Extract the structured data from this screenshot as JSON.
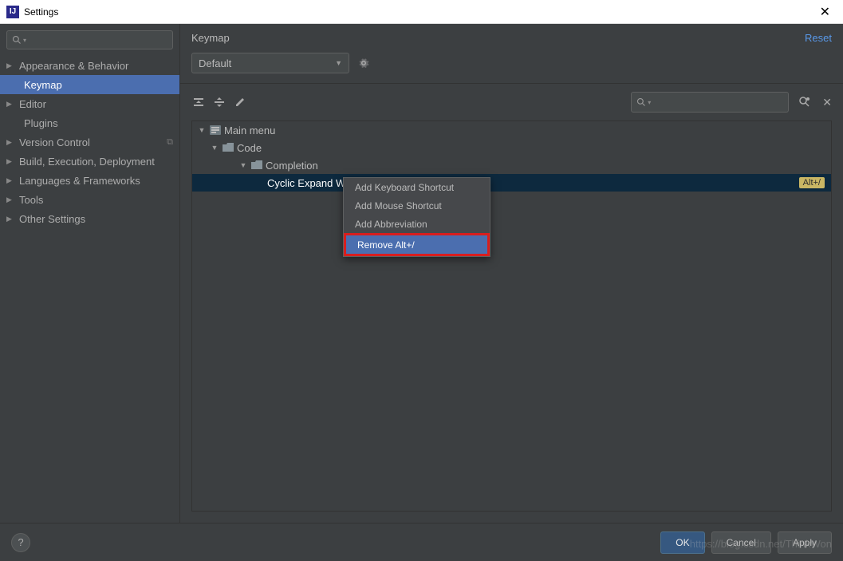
{
  "window": {
    "title": "Settings"
  },
  "sidebar": {
    "items": [
      {
        "label": "Appearance & Behavior",
        "expandable": true
      },
      {
        "label": "Keymap",
        "selected": true
      },
      {
        "label": "Editor",
        "expandable": true
      },
      {
        "label": "Plugins"
      },
      {
        "label": "Version Control",
        "expandable": true,
        "has_copy": true
      },
      {
        "label": "Build, Execution, Deployment",
        "expandable": true
      },
      {
        "label": "Languages & Frameworks",
        "expandable": true
      },
      {
        "label": "Tools",
        "expandable": true
      },
      {
        "label": "Other Settings",
        "expandable": true
      }
    ]
  },
  "content": {
    "title": "Keymap",
    "reset_label": "Reset",
    "keymap_selected": "Default",
    "tree": {
      "main_menu": "Main menu",
      "code": "Code",
      "completion": "Completion",
      "selected_action": "Cyclic Expand Word",
      "selected_shortcut": "Alt+/"
    }
  },
  "context_menu": {
    "items": [
      "Add Keyboard Shortcut",
      "Add Mouse Shortcut",
      "Add Abbreviation",
      "Remove Alt+/"
    ]
  },
  "footer": {
    "ok": "OK",
    "cancel": "Cancel",
    "apply": "Apply",
    "help": "?"
  },
  "watermark": "https://blog.csdn.net/ThinkWon"
}
